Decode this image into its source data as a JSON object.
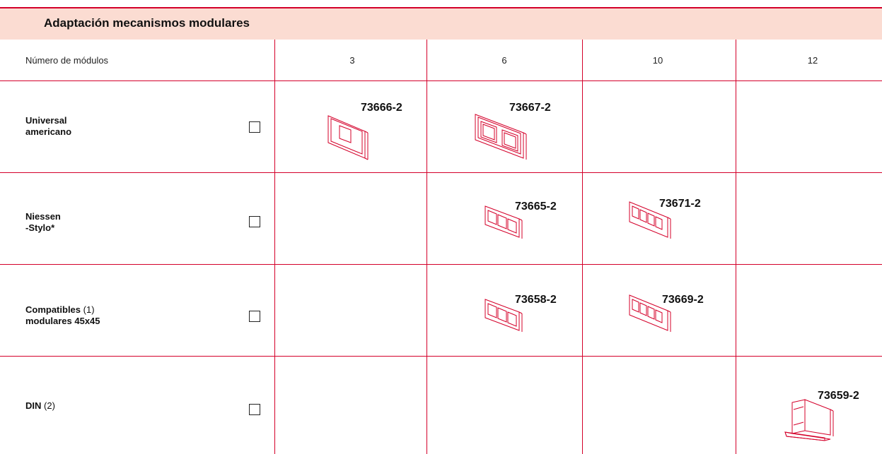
{
  "title": "Adaptación mecanismos modulares",
  "header": {
    "label": "Número de módulos",
    "columns": [
      "3",
      "6",
      "10",
      "12"
    ]
  },
  "rows": [
    {
      "label_line1": "Universal",
      "label_line2": "americano",
      "products": [
        {
          "column": "3",
          "code": "73666-2",
          "icon": "plate-1-window-icon"
        },
        {
          "column": "6",
          "code": "73667-2",
          "icon": "plate-2-window-icon"
        }
      ]
    },
    {
      "label_line1": "Niessen",
      "label_line2": "-Stylo*",
      "products": [
        {
          "column": "6",
          "code": "73665-2",
          "icon": "plate-3-module-icon"
        },
        {
          "column": "10",
          "code": "73671-2",
          "icon": "plate-5-module-icon"
        }
      ]
    },
    {
      "label_bold": "Compatibles",
      "label_note": "(1)",
      "label_line2": "modulares 45x45",
      "products": [
        {
          "column": "6",
          "code": "73658-2",
          "icon": "plate-3-module-icon"
        },
        {
          "column": "10",
          "code": "73669-2",
          "icon": "plate-5-module-icon"
        }
      ]
    },
    {
      "label_bold": "DIN",
      "label_note": "(2)",
      "products": [
        {
          "column": "12",
          "code": "73659-2",
          "icon": "din-rail-adapter-icon"
        }
      ]
    }
  ],
  "colors": {
    "accent": "#d4002a",
    "title_bg": "#fbdcd2"
  }
}
